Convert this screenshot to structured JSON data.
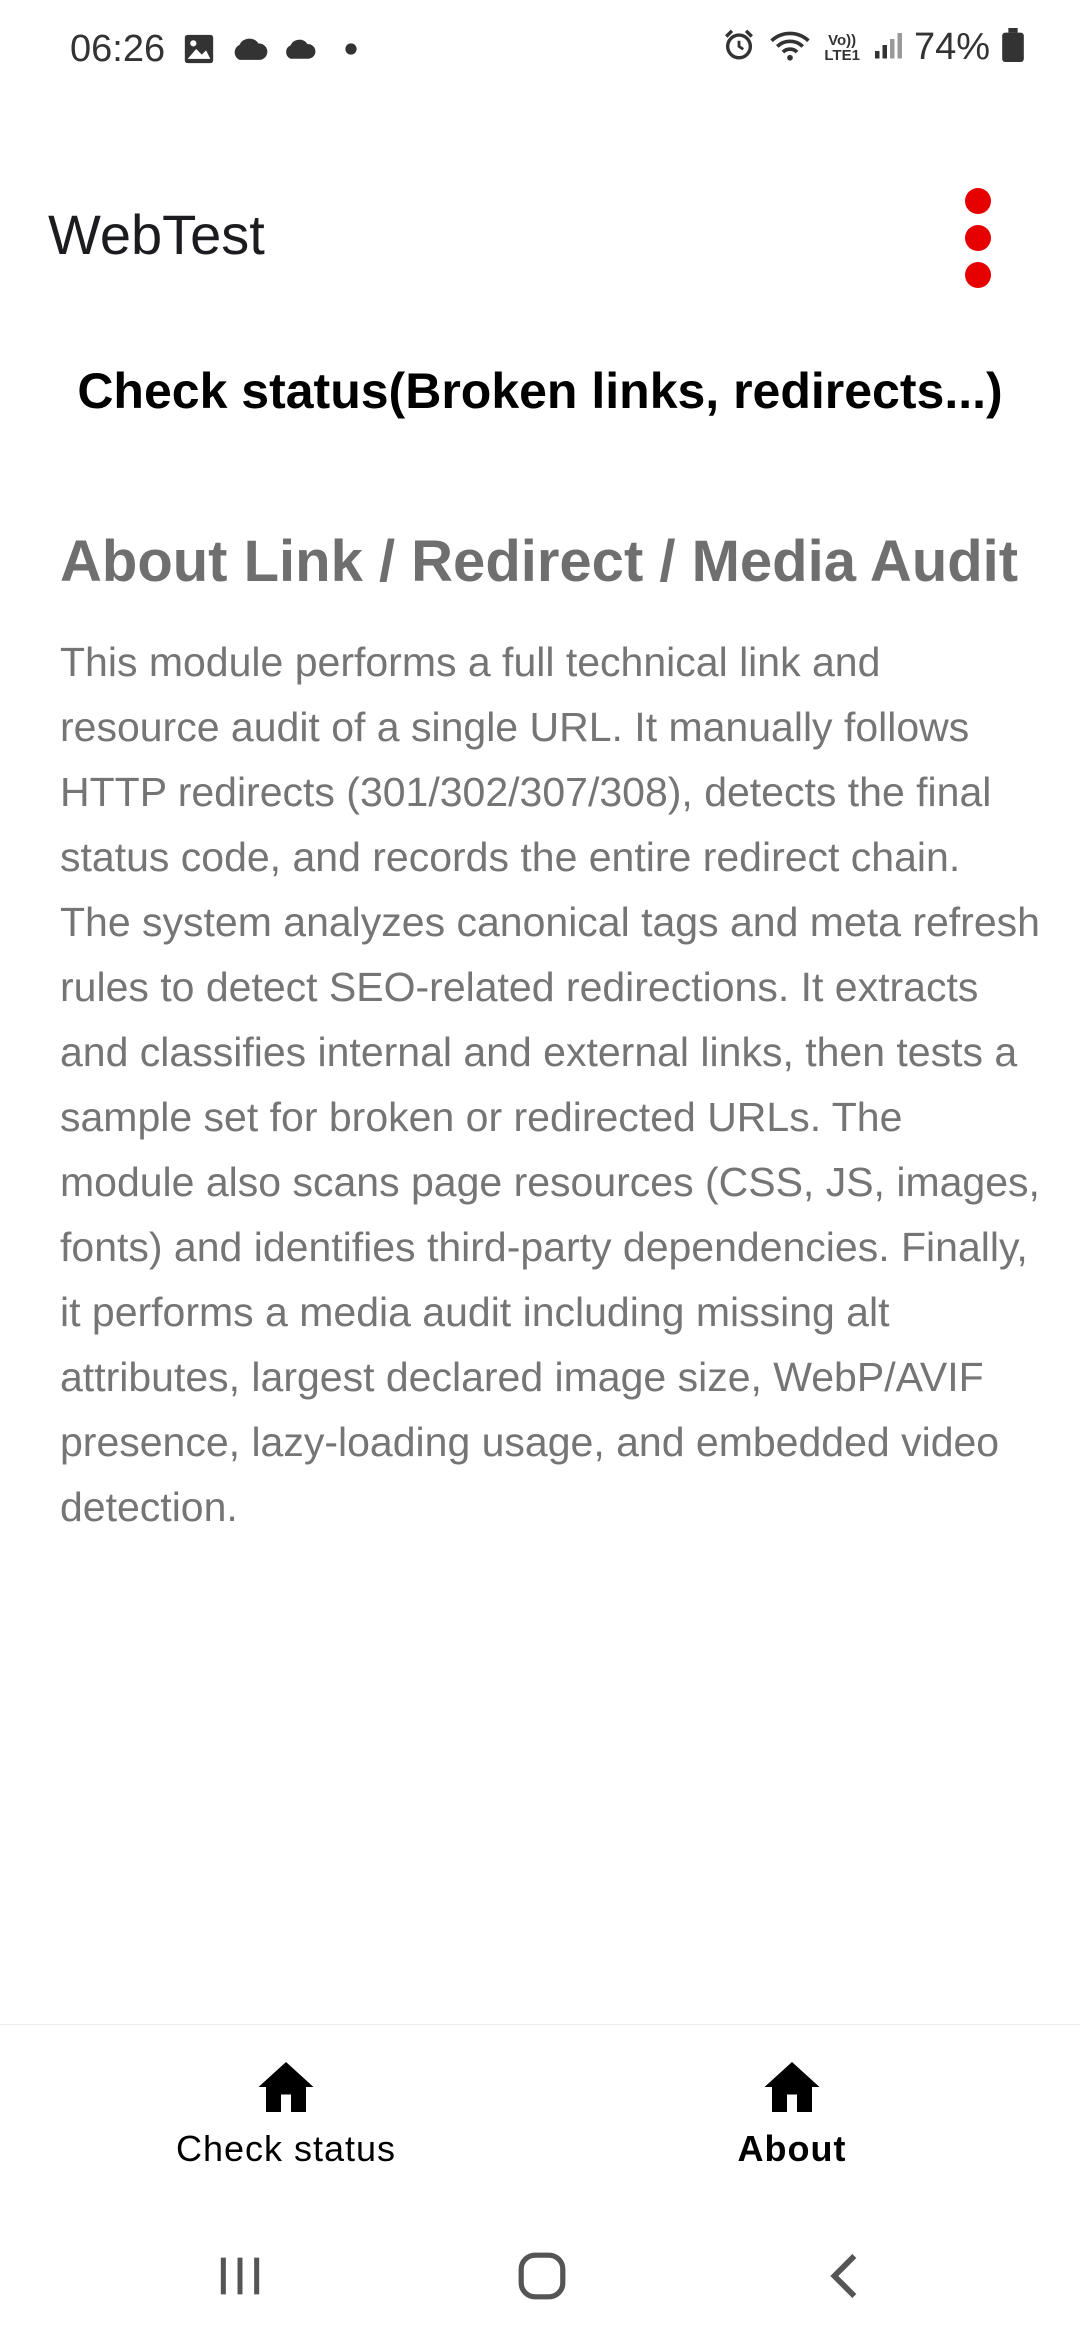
{
  "status_bar": {
    "time": "06:26",
    "battery": "74%",
    "volte_top": "Vo))",
    "volte_bottom": "LTE1",
    "icons": [
      "image-icon",
      "cloud-icon",
      "cloud-icon",
      "dot-icon",
      "alarm-icon",
      "wifi-icon",
      "signal-icon",
      "battery-icon"
    ]
  },
  "app_bar": {
    "title": "WebTest",
    "menu_icon": "more-vert-icon",
    "menu_color": "#e60000"
  },
  "content": {
    "heading": "Check status(Broken links, redirects...)",
    "about_title": "About Link / Redirect / Media Audit",
    "about_body": "This module performs a full technical link and resource audit of a single URL. It manually follows HTTP redirects (301/302/307/308), detects the final status code, and records the entire redirect chain. The system analyzes canonical tags and meta refresh rules to detect SEO-related redirections. It extracts and classifies internal and external links, then tests a sample set for broken or redirected URLs. The module also scans page resources (CSS, JS, images, fonts) and identifies third-party dependencies. Finally, it performs a media audit including missing alt attributes, largest declared image size, WebP/AVIF presence, lazy-loading usage, and embedded video detection."
  },
  "bottom_nav": {
    "items": [
      {
        "label": "Check status",
        "icon": "home-icon",
        "active": false
      },
      {
        "label": "About",
        "icon": "home-icon",
        "active": true
      }
    ]
  },
  "system_nav": {
    "buttons": [
      "recents-icon",
      "home-button-icon",
      "back-icon"
    ]
  }
}
